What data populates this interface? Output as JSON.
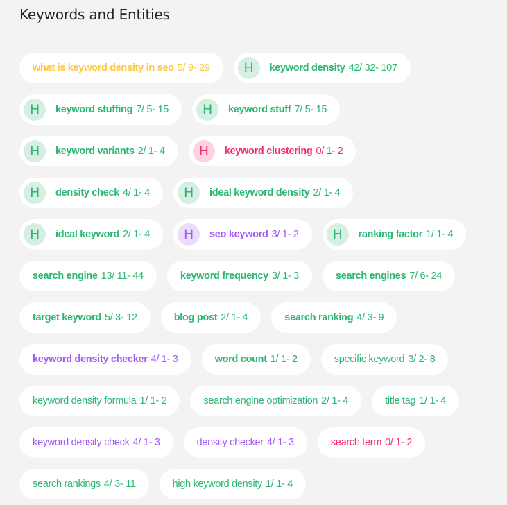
{
  "header": {
    "title": "Keywords and Entities"
  },
  "colors": {
    "green": "#2bb673",
    "yellow": "#ffc83b",
    "red": "#ef2b6b",
    "purple": "#a35af5",
    "chip_bg": "#ffffff",
    "page_bg": "#f3f3f3"
  },
  "keywords": [
    {
      "term": "what is keyword density in seo",
      "count": "5/ 9- 29",
      "color": "yellow",
      "heading": false,
      "bold": true
    },
    {
      "term": "keyword density",
      "count": "42/ 32- 107",
      "color": "green",
      "heading": true,
      "badge": "H",
      "bold": true
    },
    {
      "term": "keyword stuffing",
      "count": "7/ 5- 15",
      "color": "green",
      "heading": true,
      "badge": "H",
      "bold": true
    },
    {
      "term": "keyword stuff",
      "count": "7/ 5- 15",
      "color": "green",
      "heading": true,
      "badge": "H",
      "bold": true
    },
    {
      "term": "keyword variants",
      "count": "2/ 1- 4",
      "color": "green",
      "heading": true,
      "badge": "H",
      "bold": true
    },
    {
      "term": "keyword clustering",
      "count": "0/ 1- 2",
      "color": "red",
      "heading": true,
      "badge": "H",
      "bold": true
    },
    {
      "term": "density check",
      "count": "4/ 1- 4",
      "color": "green",
      "heading": true,
      "badge": "H",
      "bold": true
    },
    {
      "term": "ideal keyword density",
      "count": "2/ 1- 4",
      "color": "green",
      "heading": true,
      "badge": "H",
      "bold": true
    },
    {
      "term": "ideal keyword",
      "count": "2/ 1- 4",
      "color": "green",
      "heading": true,
      "badge": "H",
      "bold": true
    },
    {
      "term": "seo keyword",
      "count": "3/ 1- 2",
      "color": "purple",
      "heading": true,
      "badge": "H",
      "bold": true
    },
    {
      "term": "ranking factor",
      "count": "1/ 1- 4",
      "color": "green",
      "heading": true,
      "badge": "H",
      "bold": true
    },
    {
      "term": "search engine",
      "count": "13/ 11- 44",
      "color": "green",
      "heading": false,
      "bold": true
    },
    {
      "term": "keyword frequency",
      "count": "3/ 1- 3",
      "color": "green",
      "heading": false,
      "bold": true
    },
    {
      "term": "search engines",
      "count": "7/ 6- 24",
      "color": "green",
      "heading": false,
      "bold": true
    },
    {
      "term": "target keyword",
      "count": "5/ 3- 12",
      "color": "green",
      "heading": false,
      "bold": true
    },
    {
      "term": "blog post",
      "count": "2/ 1- 4",
      "color": "green",
      "heading": false,
      "bold": true
    },
    {
      "term": "search ranking",
      "count": "4/ 3- 9",
      "color": "green",
      "heading": false,
      "bold": true
    },
    {
      "term": "keyword density checker",
      "count": "4/ 1- 3",
      "color": "purple",
      "heading": false,
      "bold": true
    },
    {
      "term": "word count",
      "count": "1/ 1- 2",
      "color": "green",
      "heading": false,
      "bold": true
    },
    {
      "term": "specific keyword",
      "count": "3/ 2- 8",
      "color": "green",
      "heading": false,
      "bold": false
    },
    {
      "term": "keyword density formula",
      "count": "1/ 1- 2",
      "color": "green",
      "heading": false,
      "bold": false
    },
    {
      "term": "search engine optimization",
      "count": "2/ 1- 4",
      "color": "green",
      "heading": false,
      "bold": false
    },
    {
      "term": "title tag",
      "count": "1/ 1- 4",
      "color": "green",
      "heading": false,
      "bold": false
    },
    {
      "term": "keyword density check",
      "count": "4/ 1- 3",
      "color": "purple",
      "heading": false,
      "bold": false
    },
    {
      "term": "density checker",
      "count": "4/ 1- 3",
      "color": "purple",
      "heading": false,
      "bold": false
    },
    {
      "term": "search term",
      "count": "0/ 1- 2",
      "color": "red",
      "heading": false,
      "bold": false
    },
    {
      "term": "search rankings",
      "count": "4/ 3- 11",
      "color": "green",
      "heading": false,
      "bold": false
    },
    {
      "term": "high keyword density",
      "count": "1/ 1- 4",
      "color": "green",
      "heading": false,
      "bold": false
    }
  ]
}
